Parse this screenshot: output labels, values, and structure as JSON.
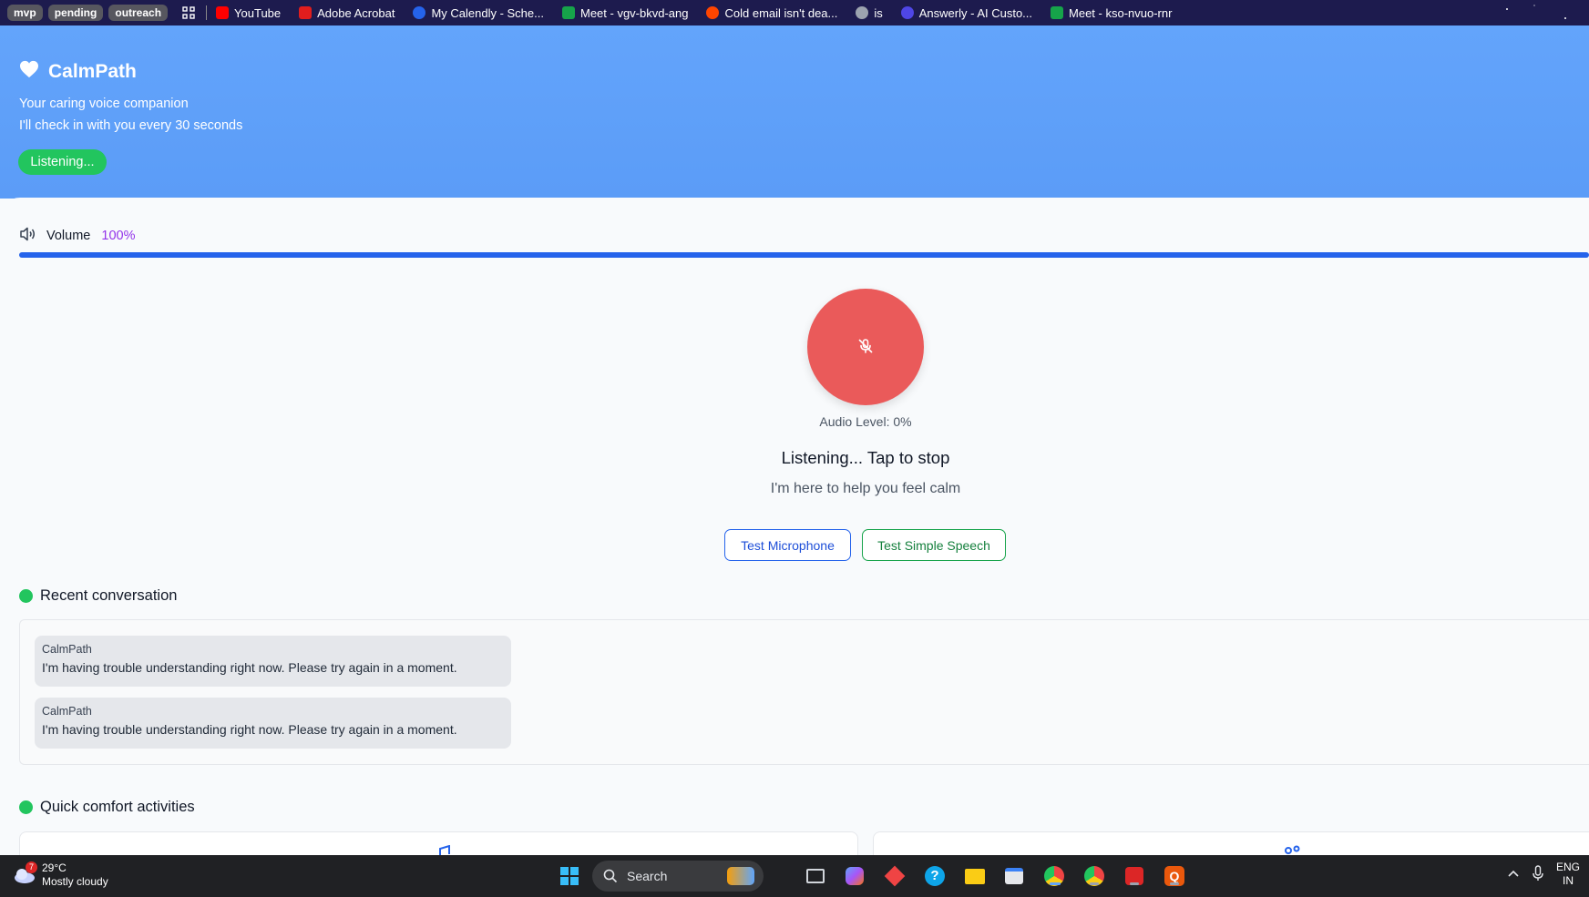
{
  "bookmarks": {
    "folders": [
      "mvp",
      "pending",
      "outreach"
    ],
    "items": [
      {
        "label": "YouTube",
        "icon": "youtube-icon",
        "color": "#ff0000"
      },
      {
        "label": "Adobe Acrobat",
        "icon": "acrobat-icon",
        "color": "#e11d1d"
      },
      {
        "label": "My Calendly - Sche...",
        "icon": "calendly-icon",
        "color": "#2563eb"
      },
      {
        "label": "Meet - vgv-bkvd-ang",
        "icon": "meet-icon",
        "color": "#16a34a"
      },
      {
        "label": "Cold email isn't dea...",
        "icon": "reddit-icon",
        "color": "#ff4500"
      },
      {
        "label": "is",
        "icon": "globe-icon",
        "color": "#9ca3af"
      },
      {
        "label": "Answerly - AI Custo...",
        "icon": "answerly-icon",
        "color": "#4f46e5"
      },
      {
        "label": "Meet - kso-nvuo-rnr",
        "icon": "meet-icon",
        "color": "#16a34a"
      }
    ]
  },
  "header": {
    "app_name": "CalmPath",
    "tagline": "Your caring voice companion",
    "checkin": "I'll check in with you every 30 seconds",
    "status": "Listening..."
  },
  "volume": {
    "label": "Volume",
    "value_text": "100%",
    "level": 1.0
  },
  "voice": {
    "audio_level": "Audio Level: 0%",
    "status": "Listening... Tap to stop",
    "help": "I'm here to help you feel calm",
    "test_mic_label": "Test Microphone",
    "test_speech_label": "Test Simple Speech"
  },
  "conversation": {
    "title": "Recent conversation",
    "messages": [
      {
        "sender": "CalmPath",
        "text": "I'm having trouble understanding right now. Please try again in a moment."
      },
      {
        "sender": "CalmPath",
        "text": "I'm having trouble understanding right now. Please try again in a moment."
      }
    ]
  },
  "activities": {
    "title": "Quick comfort activities"
  },
  "taskbar": {
    "temperature": "29°C",
    "condition": "Mostly cloudy",
    "weather_badge": "7",
    "search_placeholder": "Search",
    "lang_top": "ENG",
    "lang_bottom": "IN"
  },
  "colors": {
    "header": "#5b9cf7",
    "accent_green": "#22c55e",
    "mic_button": "#ea5a5a",
    "volume_fill": "#2563eb",
    "volume_value": "#9333ea"
  }
}
